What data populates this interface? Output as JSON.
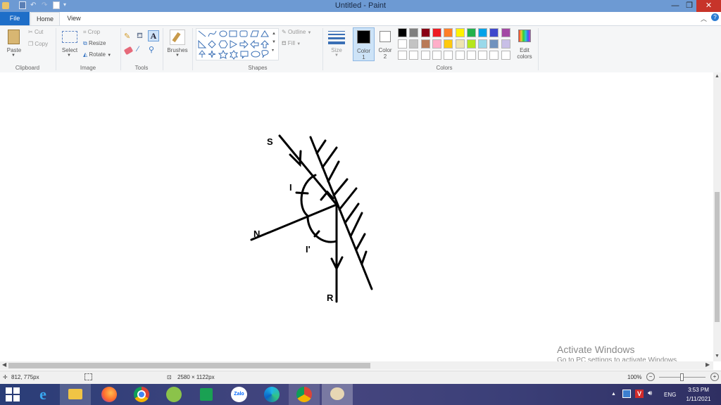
{
  "window": {
    "title": "Untitled - Paint"
  },
  "tabs": [
    {
      "label": "File"
    },
    {
      "label": "Home"
    },
    {
      "label": "View"
    }
  ],
  "ribbon": {
    "clipboard": {
      "paste": "Paste",
      "cut": "Cut",
      "copy": "Copy",
      "group": "Clipboard"
    },
    "image": {
      "select": "Select",
      "crop": "Crop",
      "resize": "Resize",
      "rotate": "Rotate",
      "group": "Image"
    },
    "tools": {
      "group": "Tools"
    },
    "brushes": {
      "label": "Brushes"
    },
    "shapes": {
      "outline": "Outline",
      "fill": "Fill",
      "group": "Shapes"
    },
    "size": {
      "label": "Size"
    },
    "color1": {
      "label": "Color",
      "num": "1",
      "value": "#000000"
    },
    "color2": {
      "label": "Color",
      "num": "2",
      "value": "#ffffff"
    },
    "colors": {
      "group": "Colors",
      "edit_label": "Edit",
      "edit_label2": "colors"
    },
    "palette_row1": [
      "#000000",
      "#7f7f7f",
      "#880015",
      "#ed1c24",
      "#ff7f27",
      "#fff200",
      "#22b14c",
      "#00a2e8",
      "#3f48cc",
      "#a349a4"
    ],
    "palette_row2": [
      "#ffffff",
      "#c3c3c3",
      "#b97a57",
      "#ffaec9",
      "#ffc90e",
      "#efe4b0",
      "#b5e61d",
      "#99d9ea",
      "#7092be",
      "#c8bfe7"
    ]
  },
  "drawing": {
    "labels": {
      "S": "S",
      "I": "I",
      "N": "N",
      "I_prime": "I'",
      "R": "R"
    }
  },
  "watermark": {
    "line1": "Activate Windows",
    "line2": "Go to PC settings to activate Windows."
  },
  "status": {
    "cursor_pos": "812, 775px",
    "image_size": "2580 × 1122px",
    "zoom": "100%"
  },
  "taskbar": {
    "lang": "ENG",
    "time": "3:53 PM",
    "date": "1/11/2021",
    "zalo": "Zalo"
  }
}
